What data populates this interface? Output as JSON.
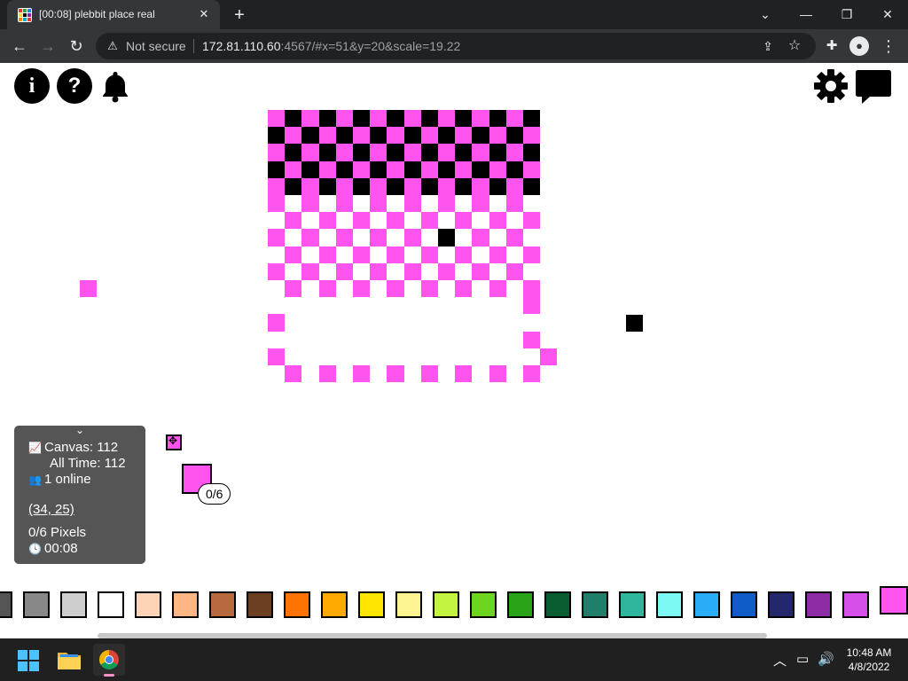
{
  "browser": {
    "tab_title": "[00:08] plebbit place real",
    "tab_close": "✕",
    "new_tab": "+",
    "window_controls": {
      "minimize": "—",
      "restore": "❐",
      "close": "✕",
      "menu": "⌄"
    },
    "nav": {
      "back": "←",
      "forward": "→",
      "reload": "↻"
    },
    "security_text": "Not secure",
    "url_host": "172.81.110.60",
    "url_rest": ":4567/#x=51&y=20&scale=19.22",
    "menu": "⋮"
  },
  "top_controls": {
    "info": "i",
    "help": "?"
  },
  "stats": {
    "canvas": "Canvas: 112",
    "all_time": "All Time: 112",
    "online": "1 online",
    "coords": "(34, 25)",
    "pixels": "0/6 Pixels",
    "timer": "00:08"
  },
  "cooldown": "0/6",
  "palette": {
    "colors": [
      "#555555",
      "#888888",
      "#cdcdcd",
      "#ffffff",
      "#ffd3b6",
      "#ffb685",
      "#b86a3f",
      "#6b3f1f",
      "#ff7300",
      "#ffa800",
      "#ffe500",
      "#fff392",
      "#c3f442",
      "#6cd41d",
      "#29a418",
      "#0a5c31",
      "#1f7f6b",
      "#30b69d",
      "#7df9f4",
      "#29adf6",
      "#0f5cc8",
      "#22286b",
      "#8e2ca6",
      "#d54fe8",
      "#ff55ee"
    ],
    "selected_index": 24
  },
  "canvas_colors": {
    "pink": "#ff55ee",
    "black": "#000000"
  },
  "taskbar": {
    "time": "10:48 AM",
    "date": "4/8/2022",
    "tray_chevron": "︿"
  }
}
